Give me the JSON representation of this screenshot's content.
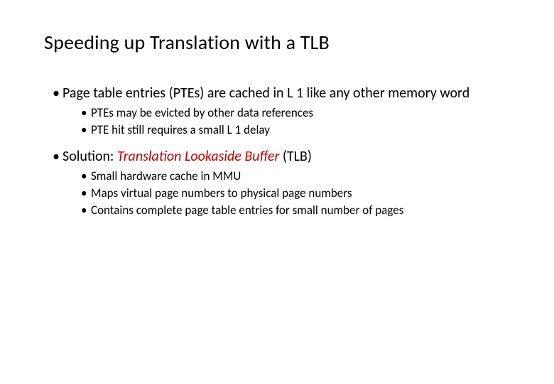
{
  "title": "Speeding up Translation with a TLB",
  "bullets": {
    "b1": "Page table entries (PTEs) are cached in L 1 like any other memory word",
    "b1_sub": {
      "s1": "PTEs may be evicted by other data references",
      "s2": "PTE hit still requires a small L 1 delay"
    },
    "b2_pre": "Solution: ",
    "b2_emph": "Translation Lookaside Buffer",
    "b2_post": " (TLB)",
    "b2_sub": {
      "s1": "Small hardware cache in MMU",
      "s2": "Maps virtual page numbers to  physical page numbers",
      "s3": "Contains complete page table entries for small number of pages"
    }
  }
}
